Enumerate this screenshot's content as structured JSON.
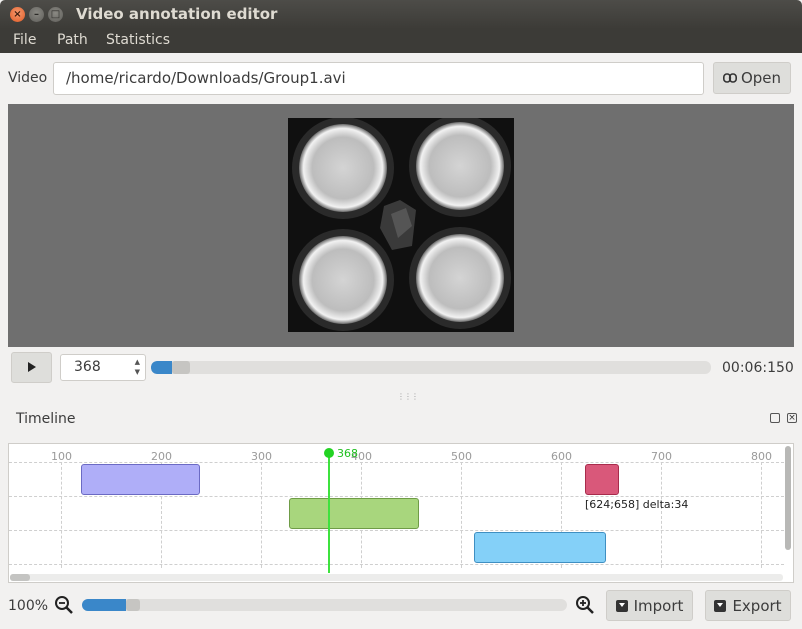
{
  "window": {
    "title": "Video annotation editor",
    "controls": {
      "close": "×",
      "minimize": "–",
      "maximize": "□"
    }
  },
  "menu": [
    "File",
    "Path",
    "Statistics"
  ],
  "video": {
    "label": "Video",
    "path": "/home/ricardo/Downloads/Group1.avi",
    "open_label": "Open",
    "open_icon": "link-icon"
  },
  "playback": {
    "play_icon": "play-icon",
    "frame_value": "368",
    "time": "00:06:150",
    "progress_fraction": 0.037
  },
  "timeline": {
    "title": "Timeline",
    "ticks": [
      "100",
      "200",
      "300",
      "400",
      "500",
      "600",
      "700",
      "800"
    ],
    "tick_values": [
      100,
      200,
      300,
      400,
      500,
      600,
      700,
      800
    ],
    "cursor_frame": 368,
    "cursor_label": "368",
    "events": [
      {
        "track": 0,
        "start": 120,
        "end": 239,
        "color": "#afaef8",
        "border": "#6b6ac4"
      },
      {
        "track": 0,
        "start": 624,
        "end": 658,
        "color": "#d9587a",
        "border": "#a82c4c",
        "label": "[624;658] delta:34"
      },
      {
        "track": 1,
        "start": 328,
        "end": 458,
        "color": "#a8d67d",
        "border": "#6f9c47"
      },
      {
        "track": 2,
        "start": 513,
        "end": 645,
        "color": "#84d0f8",
        "border": "#3f8fc2"
      }
    ]
  },
  "zoom": {
    "value": "100%",
    "level_fraction": 0.09,
    "zoom_out_icon": "zoom-out-icon",
    "zoom_in_icon": "zoom-in-icon"
  },
  "actions": {
    "import_label": "Import",
    "export_label": "Export",
    "import_icon": "import-icon",
    "export_icon": "export-icon"
  },
  "colors": {
    "accent": "#3a87c9",
    "cursor": "#22d322",
    "titlebar": "#3c3b37"
  }
}
